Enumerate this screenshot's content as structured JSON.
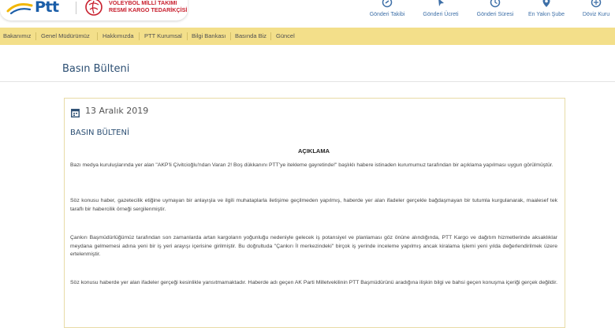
{
  "header": {
    "brand": "Ptt",
    "partner_line1": "VOLEYBOL MİLLİ TAKIMI",
    "partner_line2": "RESMİ KARGO TEDARİKÇİSİ",
    "brand_color": "#1a5da8",
    "partner_color": "#c8202e"
  },
  "top_nav": [
    {
      "label": "Gönderi Takibi",
      "icon": "tracking-icon"
    },
    {
      "label": "Gönderi Ücreti",
      "icon": "cursor-icon"
    },
    {
      "label": "Gönderi Süresi",
      "icon": "clock-icon"
    },
    {
      "label": "En Yakın Şube",
      "icon": "map-pin-icon"
    },
    {
      "label": "Döviz Kuru",
      "icon": "currency-icon"
    }
  ],
  "main_menu": [
    {
      "label": "Bakanımız"
    },
    {
      "label": "Genel Müdürümüz"
    },
    {
      "label": "Hakkımızda"
    },
    {
      "label": "PTT Kurumsal"
    },
    {
      "label": "Bilgi Bankası"
    },
    {
      "label": "Basında Biz"
    },
    {
      "label": "Güncel"
    }
  ],
  "page": {
    "title": "Basın Bülteni"
  },
  "article": {
    "date": "13 Aralık 2019",
    "title": "BASIN BÜLTENİ",
    "heading": "AÇIKLAMA",
    "paragraphs": [
      "Bazı medya kuruluşlarında yer alan \"AKP'li Çivitcioğlu'ndan Varan 2! Boş dükkanını PTT'ye itekleme gayretinde!\" başlıklı habere istinaden kurumumuz tarafından bir açıklama yapılması uygun görülmüştür.",
      "Söz konusu haber, gazetecilik etiğine uymayan bir anlayışla ve ilgili muhataplarla iletişime geçilmeden yapılmış, haberde yer alan ifadeler gerçekle bağdaşmayan bir tutumla kurgulanarak, maalesef tek taraflı bir habercilik örneği sergilenmiştir.",
      "Çankırı Başmüdürlüğümüz tarafından son zamanlarda artan kargoların yoğunluğu nedeniyle gelecek iş potansiyel ve planlaması göz önüne alındığında, PTT Kargo ve dağıtım hizmetlerinde aksaklıklar meydana gelmemesi adına yeni bir iş yeri arayışı içerisine girilmiştir. Bu doğrultuda \"Çankırı İl merkezindeki\" birçok iş yerinde inceleme yapılmış ancak kiralama işlemi yeni yılda değerlendirilmek üzere ertelenmiştir.",
      "Söz konusu haberde yer alan ifadeler gerçeği kesinlikle yansıtmamaktadır. Haberde adı geçen AK Parti Milletvekilinin PTT Başmüdürünü aradığına ilişkin bilgi ve bahsi geçen konuşma içeriği gerçek değildir."
    ]
  },
  "colors": {
    "menu_bg": "#f3df8a",
    "title_color": "#2c4f73",
    "card_border": "#e8dba6"
  }
}
